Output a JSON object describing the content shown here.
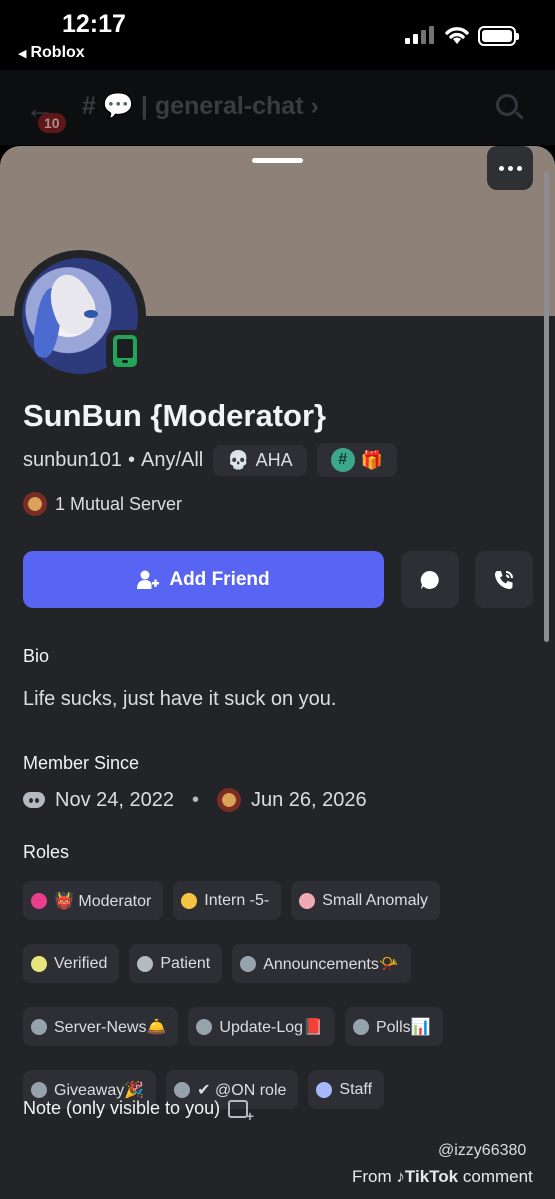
{
  "status_bar": {
    "time": "12:17",
    "back_app": "Roblox"
  },
  "channel_header": {
    "badge": "10",
    "name": "# 💬 | general-chat ›"
  },
  "profile": {
    "display_name": "SunBun {Moderator}",
    "username": "sunbun101",
    "separator": "•",
    "pronouns": "Any/All",
    "tag_emoji": "💀",
    "tag": "AHA",
    "badge_hash": "#",
    "badge_gift": "🎁",
    "mutual_servers": "1 Mutual Server",
    "add_friend_label": "Add Friend"
  },
  "bio": {
    "label": "Bio",
    "text": "Life sucks, just have it suck on you."
  },
  "member_since": {
    "label": "Member Since",
    "discord_date": "Nov 24, 2022",
    "dot": "•",
    "server_date": "Jun 26, 2026"
  },
  "roles": {
    "label": "Roles",
    "items": [
      {
        "label": "👹 Moderator",
        "color": "#e83e8c"
      },
      {
        "label": "Intern -5-",
        "color": "#f5c542"
      },
      {
        "label": "Small Anomaly",
        "color": "#f0aab4"
      },
      {
        "label": "Verified",
        "color": "#e6e67a"
      },
      {
        "label": "Patient",
        "color": "#b5bac1"
      },
      {
        "label": "Announcements📯",
        "color": "#96a3ad"
      },
      {
        "label": "Server-News🛎️",
        "color": "#96a3ad"
      },
      {
        "label": "Update-Log📕",
        "color": "#96a3ad"
      },
      {
        "label": "Polls📊",
        "color": "#96a3ad"
      },
      {
        "label": "Giveaway🎉",
        "color": "#96a3ad"
      },
      {
        "label": "✔ @ON role",
        "color": "#96a3ad"
      },
      {
        "label": "Staff",
        "color": "#a8b8ff"
      }
    ]
  },
  "note": {
    "label": "Note (only visible to you)"
  },
  "watermark": {
    "user": "@izzy66380",
    "from": "From",
    "brand": "TikTok",
    "suffix": "comment"
  }
}
